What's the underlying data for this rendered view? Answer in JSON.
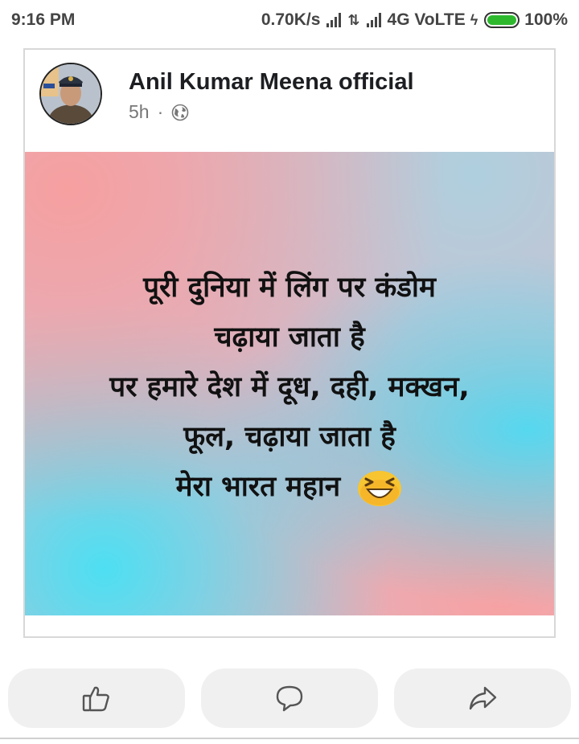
{
  "status_bar": {
    "time": "9:16 PM",
    "net_speed": "0.70K/s",
    "network": "4G VoLTE",
    "battery": "100%",
    "battery_level": 1.0,
    "icons": [
      "signal-icon",
      "data-arrows-icon",
      "signal-icon",
      "charging-icon",
      "battery-icon"
    ]
  },
  "post": {
    "author": "Anil Kumar Meena official",
    "time": "5h",
    "separator": "·",
    "privacy_icon": "globe-icon",
    "lines": [
      "पूरी दुनिया में लिंग पर कंडोम",
      "चढ़ाया जाता है",
      "पर हमारे देश में दूध, दही, मक्खन,",
      "फूल, चढ़ाया जाता है",
      "मेरा भारत महान"
    ],
    "emoji": "laughing-face-emoji"
  },
  "actions": {
    "icons": [
      "thumbs-up-icon",
      "comment-icon",
      "share-icon"
    ]
  },
  "colors": {
    "gradient_pink": "#f89e9e",
    "gradient_cyan": "#46dcf5",
    "action_bg": "#f0f0f0",
    "battery_green": "#2eb82e"
  }
}
